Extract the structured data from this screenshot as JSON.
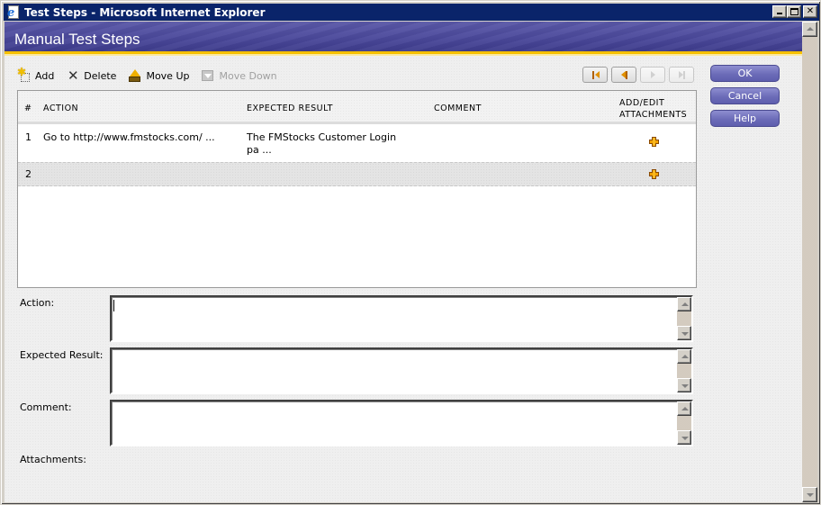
{
  "window": {
    "title": "Test Steps - Microsoft Internet Explorer",
    "controls": [
      "minimize",
      "maximize",
      "close"
    ]
  },
  "header": {
    "title": "Manual Test Steps"
  },
  "toolbar": {
    "items": [
      {
        "label": "Add",
        "icon": "add-icon",
        "enabled": true
      },
      {
        "label": "Delete",
        "icon": "delete-icon",
        "enabled": true
      },
      {
        "label": "Move Up",
        "icon": "move-up-icon",
        "enabled": true
      },
      {
        "label": "Move Down",
        "icon": "move-down-icon",
        "enabled": false
      }
    ]
  },
  "pager": {
    "buttons": [
      {
        "name": "first",
        "enabled": true
      },
      {
        "name": "previous",
        "enabled": true
      },
      {
        "name": "next",
        "enabled": false
      },
      {
        "name": "last",
        "enabled": false
      }
    ]
  },
  "actions": {
    "ok": "OK",
    "cancel": "Cancel",
    "help": "Help"
  },
  "grid": {
    "columns": {
      "num": "#",
      "action": "ACTION",
      "expected": "EXPECTED RESULT",
      "comment": "COMMENT",
      "attach_line1": "ADD/EDIT",
      "attach_line2": "ATTACHMENTS"
    },
    "rows": [
      {
        "num": "1",
        "action": "Go to http://www.fmstocks.com/ ...",
        "expected_line1": "The FMStocks Customer Login",
        "expected_line2": "pa ...",
        "comment": "",
        "attachment_icon": "add-attachment-icon"
      },
      {
        "num": "2",
        "action": "",
        "expected_line1": "",
        "expected_line2": "",
        "comment": "",
        "attachment_icon": "add-attachment-icon"
      }
    ]
  },
  "form": {
    "action_label": "Action:",
    "action_value": "",
    "expected_label": "Expected Result:",
    "expected_value": "",
    "comment_label": "Comment:",
    "comment_value": "",
    "attachments_label": "Attachments:"
  },
  "colors": {
    "titlebar": "#0a246a",
    "header_band": "#4c4a9c",
    "header_accent": "#f6c000",
    "button": "#6c6cb8",
    "attachment_plus": "#f0a000"
  }
}
